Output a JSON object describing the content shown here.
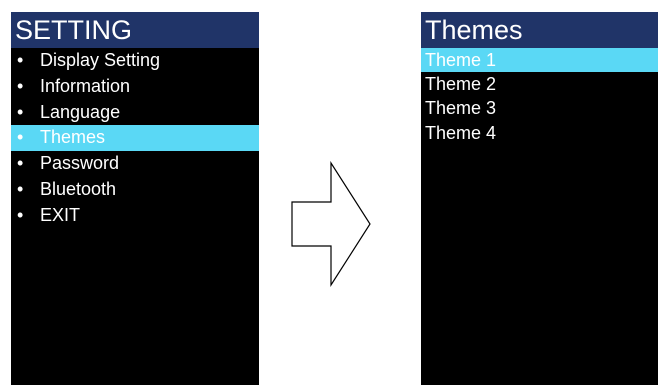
{
  "left_screen": {
    "title": "SETTING",
    "bullet": "•",
    "items": [
      {
        "label": "Display Setting"
      },
      {
        "label": "Information"
      },
      {
        "label": "Language"
      },
      {
        "label": "Themes",
        "selected": true
      },
      {
        "label": "Password"
      },
      {
        "label": "Bluetooth"
      },
      {
        "label": "EXIT"
      }
    ]
  },
  "right_screen": {
    "title": "Themes",
    "items": [
      {
        "label": "Theme 1",
        "selected": true
      },
      {
        "label": "Theme 2"
      },
      {
        "label": "Theme 3"
      },
      {
        "label": "Theme 4"
      }
    ]
  },
  "arrow": {
    "icon": "arrow-right-outline-icon"
  },
  "colors": {
    "header_bg": "#203468",
    "screen_bg": "#000000",
    "highlight": "#5ad8f5",
    "text": "#ffffff"
  }
}
